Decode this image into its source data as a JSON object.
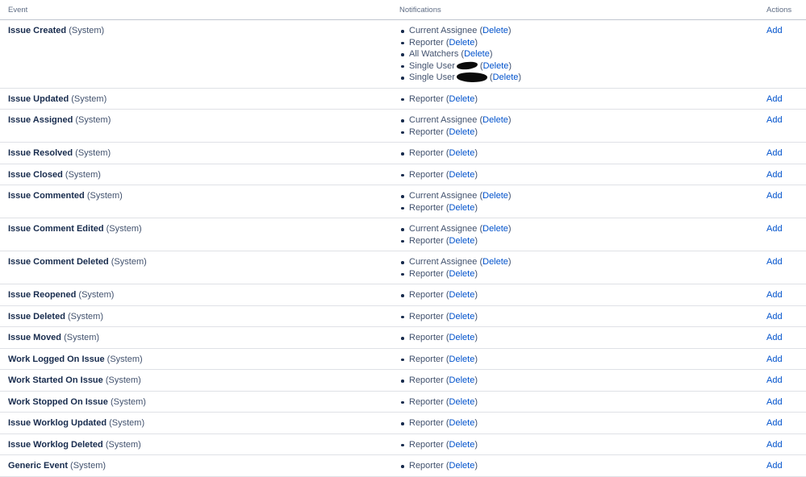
{
  "headers": {
    "event": "Event",
    "notifications": "Notifications",
    "actions": "Actions"
  },
  "system_suffix": "(System)",
  "add_label": "Add",
  "delete_label": "Delete",
  "rows": [
    {
      "event": "Issue Created",
      "notifications": [
        {
          "text": "Current Assignee"
        },
        {
          "text": "Reporter"
        },
        {
          "text": "All Watchers"
        },
        {
          "text": "Single User",
          "redacted": "short"
        },
        {
          "text": "Single User",
          "redacted": "long"
        }
      ]
    },
    {
      "event": "Issue Updated",
      "notifications": [
        {
          "text": "Reporter"
        }
      ]
    },
    {
      "event": "Issue Assigned",
      "notifications": [
        {
          "text": "Current Assignee"
        },
        {
          "text": "Reporter"
        }
      ]
    },
    {
      "event": "Issue Resolved",
      "notifications": [
        {
          "text": "Reporter"
        }
      ]
    },
    {
      "event": "Issue Closed",
      "notifications": [
        {
          "text": "Reporter"
        }
      ]
    },
    {
      "event": "Issue Commented",
      "notifications": [
        {
          "text": "Current Assignee"
        },
        {
          "text": "Reporter"
        }
      ]
    },
    {
      "event": "Issue Comment Edited",
      "notifications": [
        {
          "text": "Current Assignee"
        },
        {
          "text": "Reporter"
        }
      ]
    },
    {
      "event": "Issue Comment Deleted",
      "notifications": [
        {
          "text": "Current Assignee"
        },
        {
          "text": "Reporter"
        }
      ]
    },
    {
      "event": "Issue Reopened",
      "notifications": [
        {
          "text": "Reporter"
        }
      ]
    },
    {
      "event": "Issue Deleted",
      "notifications": [
        {
          "text": "Reporter"
        }
      ]
    },
    {
      "event": "Issue Moved",
      "notifications": [
        {
          "text": "Reporter"
        }
      ]
    },
    {
      "event": "Work Logged On Issue",
      "notifications": [
        {
          "text": "Reporter"
        }
      ]
    },
    {
      "event": "Work Started On Issue",
      "notifications": [
        {
          "text": "Reporter"
        }
      ]
    },
    {
      "event": "Work Stopped On Issue",
      "notifications": [
        {
          "text": "Reporter"
        }
      ]
    },
    {
      "event": "Issue Worklog Updated",
      "notifications": [
        {
          "text": "Reporter"
        }
      ]
    },
    {
      "event": "Issue Worklog Deleted",
      "notifications": [
        {
          "text": "Reporter"
        }
      ]
    },
    {
      "event": "Generic Event",
      "notifications": [
        {
          "text": "Reporter"
        }
      ]
    }
  ],
  "colors": {
    "link": "#0052cc",
    "text": "#172b4d",
    "muted": "#42526e",
    "header": "#5e6c84"
  }
}
